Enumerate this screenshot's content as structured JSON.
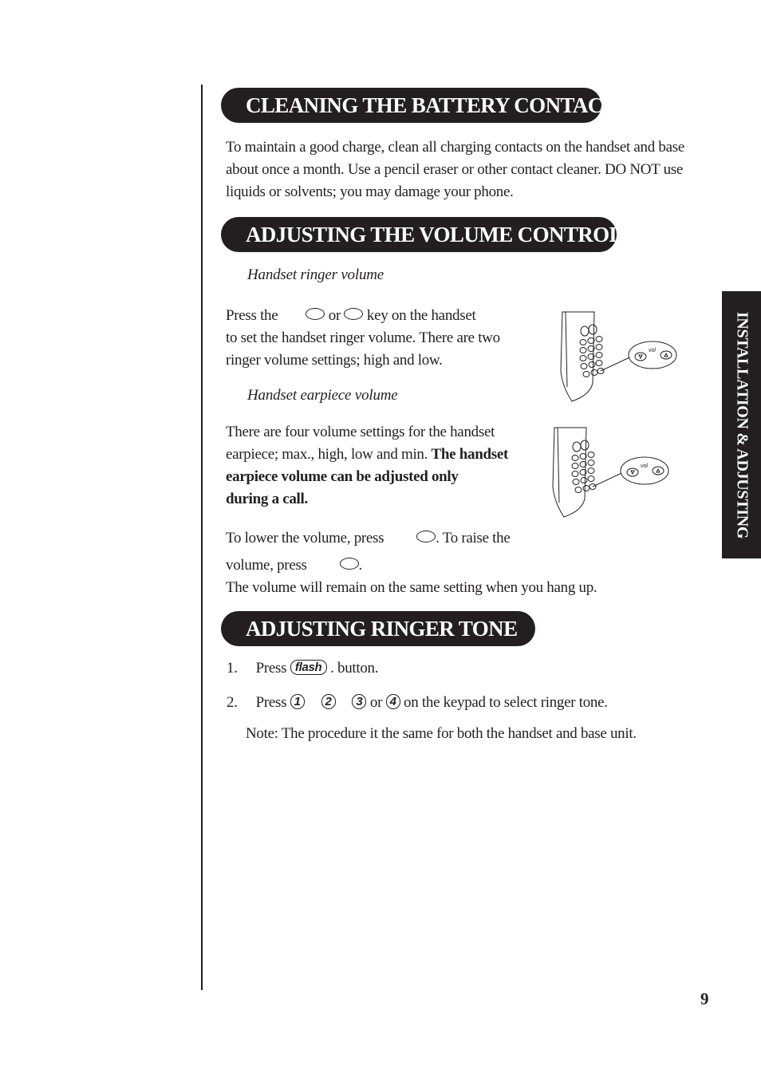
{
  "sections": {
    "cleaning": {
      "title": "CLEANING THE BATTERY CONTACTS",
      "lines": [
        "To maintain a good charge, clean all charging contacts on the handset and base",
        "about once a month. Use a pencil eraser or other contact cleaner. DO NOT use",
        "liquids or solvents; you may damage your phone."
      ]
    },
    "volume": {
      "title": "ADJUSTING THE VOLUME CONTROLS",
      "ringer": {
        "subtitle": "Handset ringer volume",
        "line1_a": "Press the",
        "line1_or": "or",
        "line1_b": "key on the handset",
        "line2": "to set the handset ringer volume. There are two",
        "line3": "ringer volume settings; high and low."
      },
      "earpiece": {
        "subtitle": "Handset earpiece volume",
        "line1": "There are four volume settings for the handset",
        "line2_a": "earpiece; max., high, low and min.",
        "line2_bold": "The handset",
        "line3_bold": "earpiece volume can be adjusted only",
        "line4_bold": "during a call.",
        "lower_a": "To lower the volume, press",
        "lower_b": ". To raise the",
        "raise_a": "volume, press",
        "raise_b": ".",
        "remain": "The volume will remain on the same setting when you hang up."
      },
      "illustration_label": "vol"
    },
    "ringer_tone": {
      "title": "ADJUSTING RINGER TONE",
      "step1": {
        "num": "1.",
        "a": "Press",
        "key": "flash",
        "b": ". button."
      },
      "step2": {
        "num": "2.",
        "a": "Press",
        "keys": [
          "1",
          "2",
          "3",
          "4"
        ],
        "or": "or",
        "b": "on the keypad to select ringer tone."
      },
      "note": "Note: The procedure it the same for both the handset and base unit."
    }
  },
  "side_tab": "INSTALLATION & ADJUSTING",
  "page_number": "9"
}
